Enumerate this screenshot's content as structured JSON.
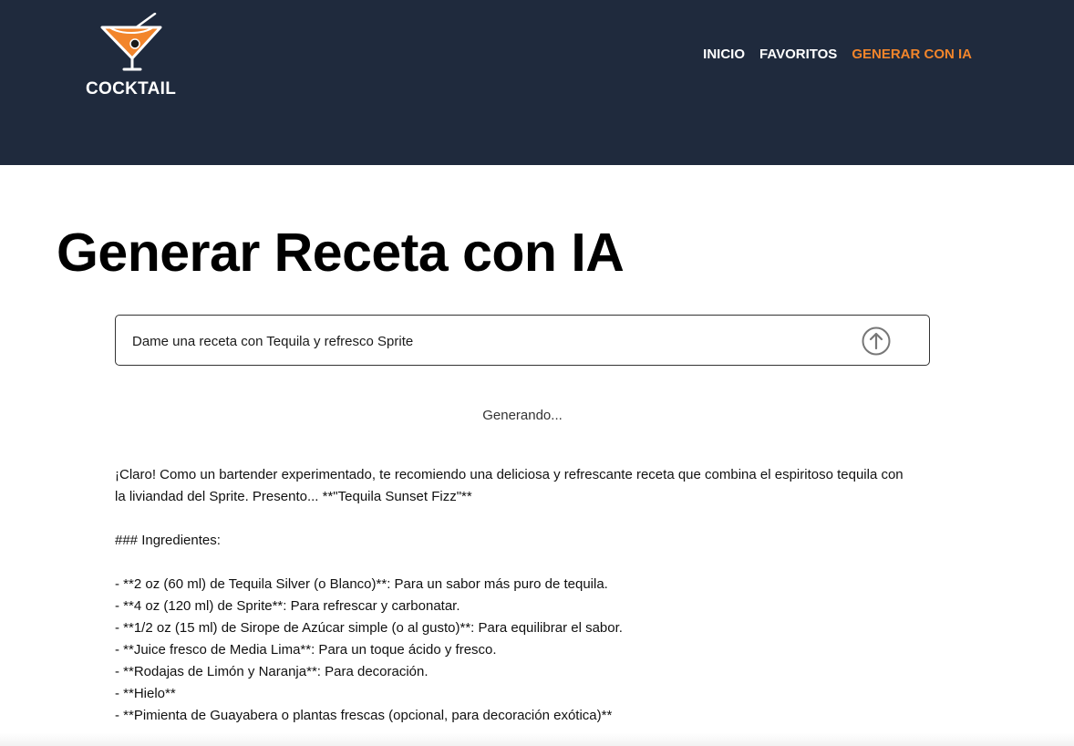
{
  "header": {
    "logo_text": "COCKTAIL",
    "logo_icon": "cocktail-glass-icon",
    "nav": [
      {
        "label": "INICIO",
        "active": false
      },
      {
        "label": "FAVORITOS",
        "active": false
      },
      {
        "label": "GENERAR CON IA",
        "active": true
      }
    ],
    "background": "#1f2a3d",
    "accent": "#f2852b"
  },
  "main": {
    "title": "Generar Receta con IA",
    "prompt": {
      "value": "Dame una receta con Tequila y refresco Sprite",
      "submit_icon": "arrow-up-circle-icon"
    },
    "status": "Generando...",
    "response": {
      "intro": "¡Claro! Como un bartender experimentado, te recomiendo una deliciosa y refrescante receta que combina el espiritoso tequila con la liviandad del Sprite. Presento... **\"Tequila Sunset Fizz\"**",
      "heading": "### Ingredientes:",
      "ingredients": [
        "- **2 oz (60 ml) de Tequila Silver (o Blanco)**: Para un sabor más puro de tequila.",
        "- **4 oz (120 ml) de Sprite**: Para refrescar y carbonatar.",
        "- **1/2 oz (15 ml) de Sirope de Azúcar simple (o al gusto)**: Para equilibrar el sabor.",
        "- **Juice fresco de Media Lima**: Para un toque ácido y fresco.",
        "- **Rodajas de Limón y Naranja**: Para decoración.",
        "- **Hielo**",
        "- **Pimienta de Guayabera o plantas frescas (opcional, para decoración exótica)**"
      ]
    }
  }
}
